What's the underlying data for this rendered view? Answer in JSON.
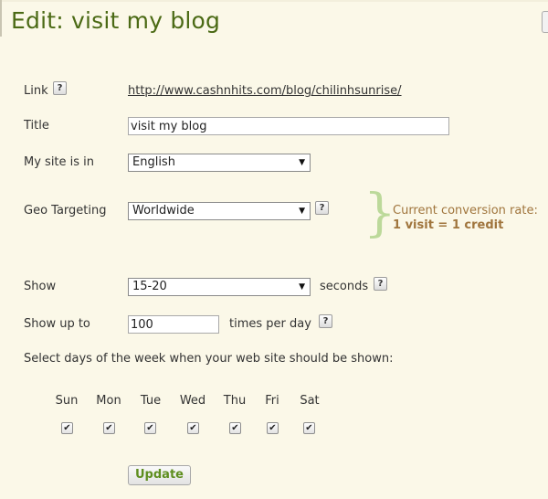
{
  "page_title": "Edit: visit my blog",
  "form": {
    "link": {
      "label": "Link",
      "value": "http://www.cashnhits.com/blog/chilinhsunrise/"
    },
    "title": {
      "label": "Title",
      "value": "visit my blog"
    },
    "site_language": {
      "label": "My site is in",
      "value": "English"
    },
    "geo_targeting": {
      "label": "Geo Targeting",
      "value": "Worldwide"
    },
    "show": {
      "label": "Show",
      "value": "15-20",
      "suffix": "seconds"
    },
    "show_up_to": {
      "label": "Show up to",
      "value": "100",
      "suffix": "times per day"
    },
    "days_prompt": "Select days of the week when your web site should be shown:",
    "days": [
      {
        "label": "Sun",
        "checked": true
      },
      {
        "label": "Mon",
        "checked": true
      },
      {
        "label": "Tue",
        "checked": true
      },
      {
        "label": "Wed",
        "checked": true
      },
      {
        "label": "Thu",
        "checked": true
      },
      {
        "label": "Fri",
        "checked": true
      },
      {
        "label": "Sat",
        "checked": true
      }
    ],
    "update_label": "Update"
  },
  "conversion": {
    "label": "Current conversion rate:",
    "value": "1 visit = 1 credit"
  },
  "help_glyph": "?",
  "colors": {
    "background": "#fbf8e8",
    "title": "#4b6a15",
    "conversion_text": "#a0753d",
    "brace": "#bcd99a",
    "update_text": "#5e8e1f"
  },
  "icons": {
    "help": "question-mark-icon",
    "dropdown": "chevron-down-icon",
    "check": "check-icon"
  }
}
